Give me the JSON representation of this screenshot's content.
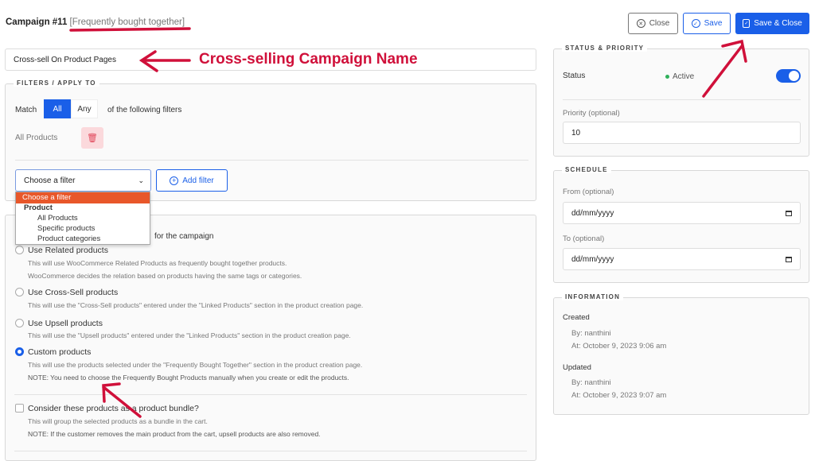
{
  "header": {
    "campaign_label": "Campaign #11",
    "campaign_type": "[Frequently bought together]"
  },
  "toolbar": {
    "close_label": "Close",
    "save_label": "Save",
    "save_close_label": "Save & Close"
  },
  "campaign_name": {
    "value": "Cross-sell On Product Pages"
  },
  "annotations": {
    "name_callout": "Cross-selling Campaign Name",
    "color": "#d0103a"
  },
  "filters": {
    "legend": "FILTERS / APPLY TO",
    "match_label": "Match",
    "match_options": [
      "All",
      "Any"
    ],
    "match_selected": "All",
    "match_suffix": "of the following filters",
    "rule_label": "All Products",
    "select_value": "Choose a filter",
    "add_filter_label": "Add filter",
    "dropdown": {
      "placeholder": "Choose a filter",
      "group": "Product",
      "options": [
        "All Products",
        "Specific products",
        "Product categories"
      ]
    }
  },
  "source": {
    "partial_label": "for the campaign",
    "options": [
      {
        "label": "Use Related products",
        "desc": [
          "This will use WooCommerce Related Products as frequently bought together products.",
          "WooCommerce decides the relation based on products having the same tags or categories."
        ],
        "checked": false
      },
      {
        "label": "Use Cross-Sell products",
        "desc": [
          "This will use the \"Cross-Sell products\" entered under the \"Linked Products\" section in the product creation page."
        ],
        "checked": false
      },
      {
        "label": "Use Upsell products",
        "desc": [
          "This will use the \"Upsell products\" entered under the \"Linked Products\" section in the product creation page."
        ],
        "checked": false
      },
      {
        "label": "Custom products",
        "desc": [
          "This will use the products selected under the \"Frequently Bought Together\" section in the product creation page.",
          "NOTE: You need to choose the Frequently Bought Products manually when you create or edit the products."
        ],
        "checked": true
      }
    ],
    "bundle": {
      "label": "Consider these products as a product bundle?",
      "desc": [
        "This will group the selected products as a bundle in the cart.",
        "NOTE: If the customer removes the main product from the cart, upsell products are also removed."
      ],
      "checked": false
    }
  },
  "status": {
    "legend": "STATUS & PRIORITY",
    "status_label": "Status",
    "status_value": "Active",
    "enabled": true,
    "priority_label": "Priority (optional)",
    "priority_value": "10"
  },
  "schedule": {
    "legend": "SCHEDULE",
    "from_label": "From (optional)",
    "from_placeholder": "dd/mm/yyyy",
    "to_label": "To (optional)",
    "to_placeholder": "dd/mm/yyyy"
  },
  "information": {
    "legend": "INFORMATION",
    "created_label": "Created",
    "created_by": "By: nanthini",
    "created_at": "At: October 9, 2023 9:06 am",
    "updated_label": "Updated",
    "updated_by": "By: nanthini",
    "updated_at": "At: October 9, 2023 9:07 am"
  },
  "colors": {
    "primary": "#1a5fe8",
    "active_dot": "#2fb05a",
    "dropdown_highlight": "#e8572a",
    "delete_bg": "#fbd9dc"
  }
}
